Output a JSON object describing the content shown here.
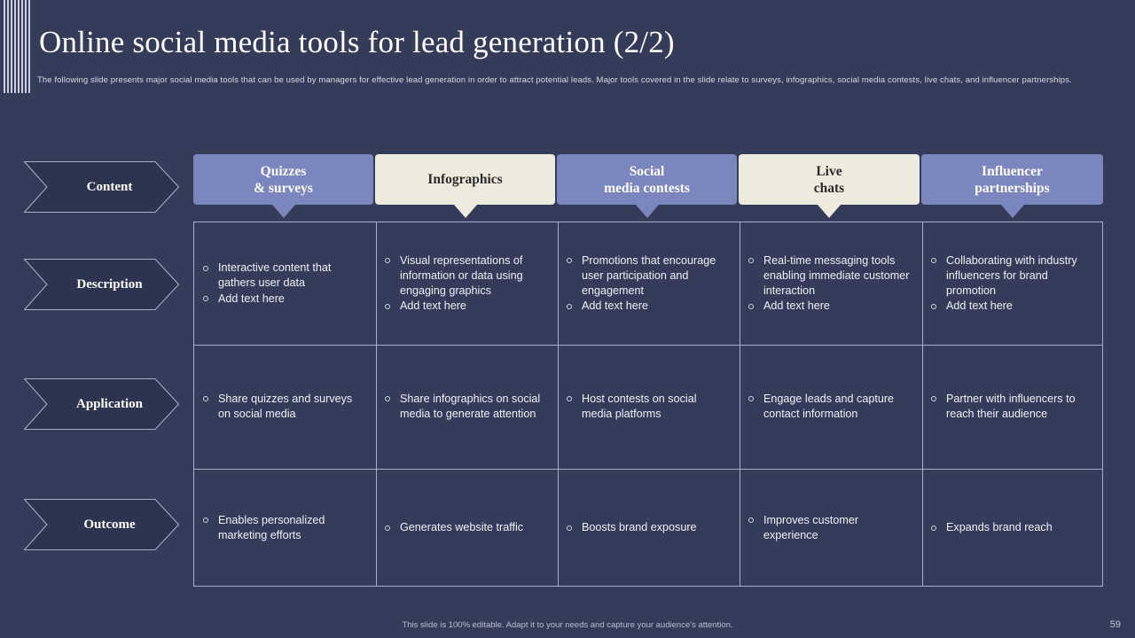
{
  "slide": {
    "title": "Online social media tools for lead generation (2/2)",
    "subtitle": "The following slide presents major social media tools that can be used by managers for effective lead generation in order to attract potential leads. Major tools covered in the slide relate to surveys, infographics, social media contests, live chats, and influencer partnerships.",
    "footer_note": "This slide is 100% editable. Adapt it to your needs and capture your audience's attention.",
    "page_number": "59"
  },
  "colors": {
    "background": "#343c59",
    "header_purple": "#7a86bd",
    "header_cream": "#edeade",
    "border": "#a9afc6",
    "arrow_fill": "#2d3450",
    "text_light": "#eef0f7"
  },
  "row_labels": [
    {
      "label": "Content"
    },
    {
      "label": "Description"
    },
    {
      "label": "Application"
    },
    {
      "label": "Outcome"
    }
  ],
  "columns": [
    {
      "title_line1": "Quizzes",
      "title_line2": "& surveys",
      "style": "purple"
    },
    {
      "title_line1": "Infographics",
      "title_line2": "",
      "style": "cream"
    },
    {
      "title_line1": "Social",
      "title_line2": "media contests",
      "style": "purple"
    },
    {
      "title_line1": "Live",
      "title_line2": "chats",
      "style": "cream"
    },
    {
      "title_line1": "Influencer",
      "title_line2": "partnerships",
      "style": "purple"
    }
  ],
  "rows": [
    {
      "name": "Description",
      "cells": [
        [
          "Interactive content that gathers user data",
          "Add text here"
        ],
        [
          "Visual representations of information or data using engaging graphics",
          "Add text here"
        ],
        [
          "Promotions that encourage user participation and engagement",
          "Add text here"
        ],
        [
          "Real-time messaging tools enabling immediate customer interaction",
          "Add text here"
        ],
        [
          "Collaborating with industry influencers for brand promotion",
          "Add text here"
        ]
      ]
    },
    {
      "name": "Application",
      "cells": [
        [
          "Share quizzes and surveys on social media"
        ],
        [
          "Share infographics on social media to generate attention"
        ],
        [
          "Host contests on social media platforms"
        ],
        [
          "Engage leads and capture contact information"
        ],
        [
          "Partner with influencers to reach their audience"
        ]
      ]
    },
    {
      "name": "Outcome",
      "cells": [
        [
          "Enables personalized marketing efforts"
        ],
        [
          "Generates website traffic"
        ],
        [
          "Boosts brand exposure"
        ],
        [
          "Improves customer experience"
        ],
        [
          "Expands brand reach"
        ]
      ]
    }
  ]
}
